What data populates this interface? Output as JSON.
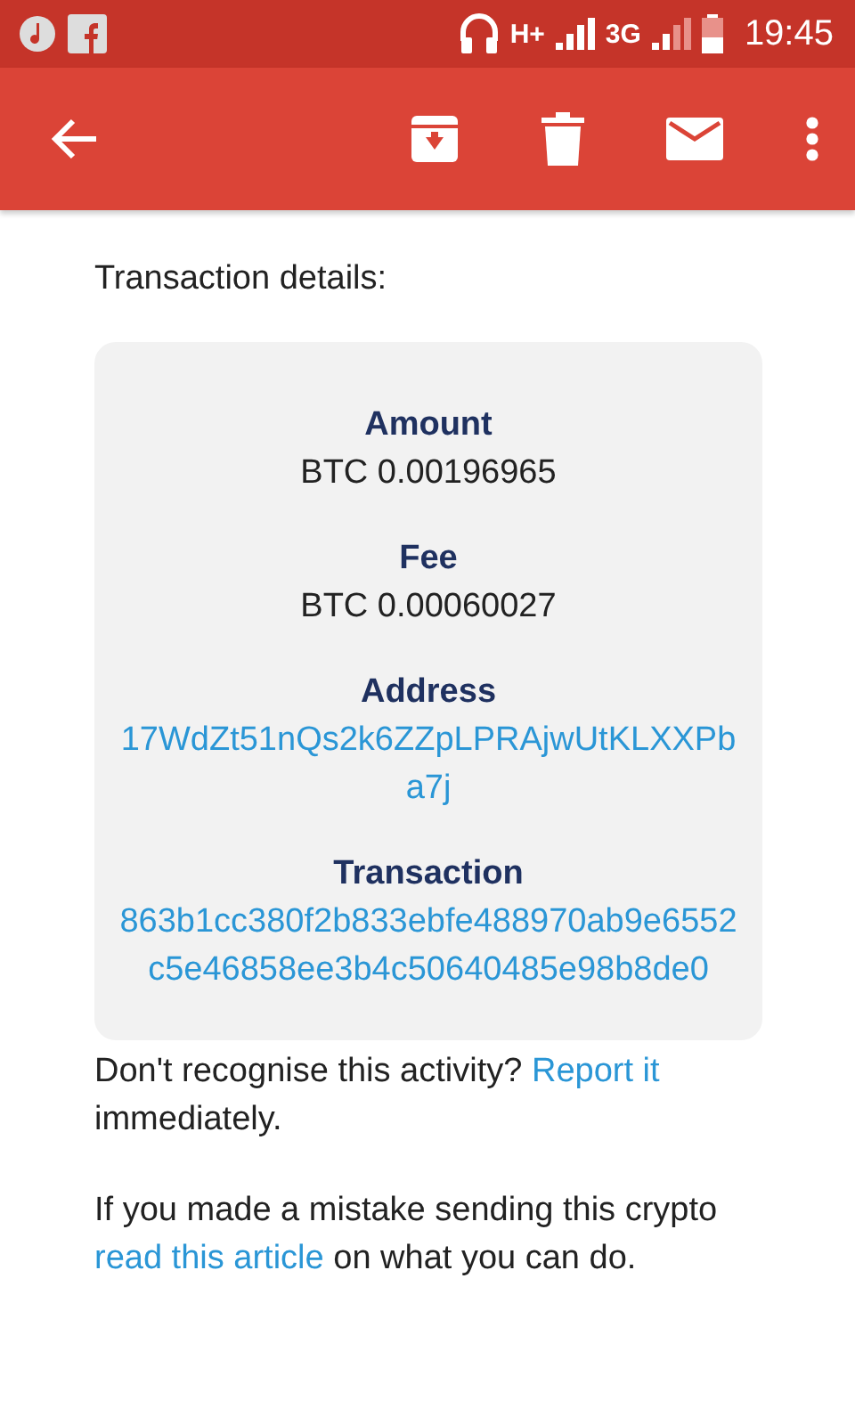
{
  "status_bar": {
    "network_1": "H+",
    "network_2": "3G",
    "time": "19:45"
  },
  "heading": "Transaction details:",
  "details": [
    {
      "label": "Amount",
      "value": "BTC 0.00196965",
      "kind": "plain"
    },
    {
      "label": "Fee",
      "value": "BTC 0.00060027",
      "kind": "plain"
    },
    {
      "label": "Address",
      "value": "17WdZt51nQs2k6ZZpLPRAjwUtKLXXPba7j",
      "kind": "link"
    },
    {
      "label": "Transaction",
      "value": "863b1cc380f2b833ebfe488970ab9e6552c5e46858ee3b4c50640485e98b8de0",
      "kind": "link"
    }
  ],
  "paragraphs": [
    [
      {
        "kind": "text",
        "text": "Don't recognise this activity?"
      },
      {
        "kind": "link",
        "text": "Report it"
      },
      {
        "kind": "text",
        "text": "immediately."
      }
    ],
    [
      {
        "kind": "text",
        "text": "If you made a mistake sending this crypto"
      },
      {
        "kind": "link",
        "text": "read this article"
      },
      {
        "kind": "text",
        "text": "on what you can do."
      }
    ]
  ]
}
